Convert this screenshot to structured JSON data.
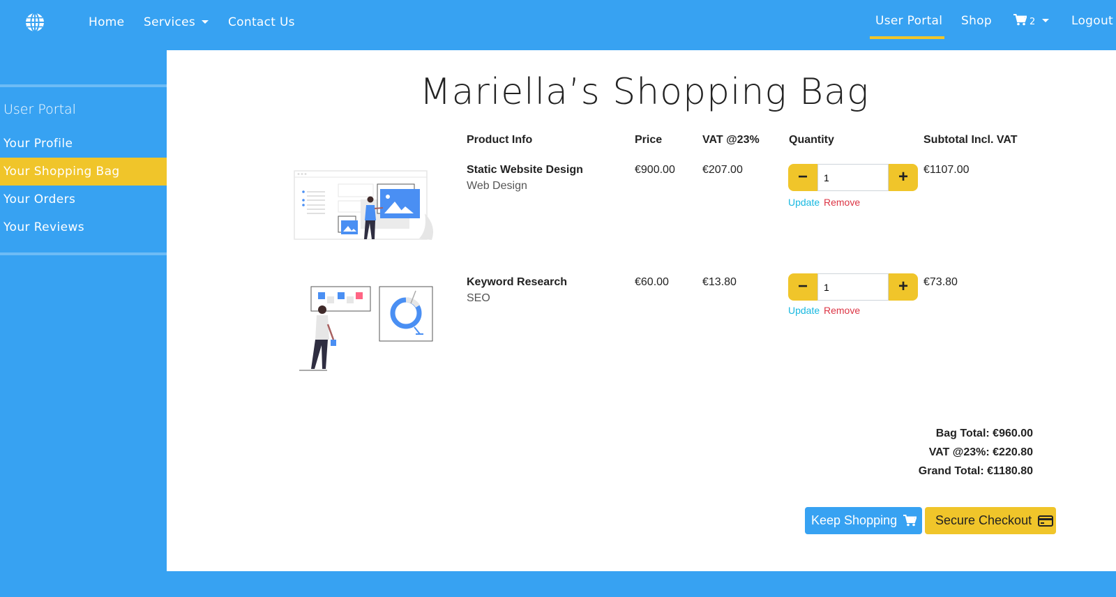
{
  "nav": {
    "logo_icon": "globe-icon",
    "home": "Home",
    "services": "Services",
    "contact": "Contact Us",
    "user_portal": "User Portal",
    "shop": "Shop",
    "cart_icon": "cart-icon",
    "cart_count": "2",
    "logout": "Logout"
  },
  "sidebar": {
    "title": "User Portal",
    "items": [
      {
        "label": "Your Profile",
        "active": false
      },
      {
        "label": "Your Shopping Bag",
        "active": true
      },
      {
        "label": "Your Orders",
        "active": false
      },
      {
        "label": "Your Reviews",
        "active": false
      }
    ]
  },
  "page": {
    "title": "Mariella’s Shopping Bag"
  },
  "table": {
    "headers": [
      "Product Info",
      "Price",
      "VAT @23%",
      "Quantity",
      "Subtotal Incl. VAT"
    ],
    "rows": [
      {
        "name": "Static Website Design",
        "category": "Web Design",
        "price": "€900.00",
        "vat": "€207.00",
        "quantity": "1",
        "subtotal": "€1107.00",
        "image_icon": "web-design-illustration"
      },
      {
        "name": "Keyword Research",
        "category": "SEO",
        "price": "€60.00",
        "vat": "€13.80",
        "quantity": "1",
        "subtotal": "€73.80",
        "image_icon": "seo-illustration"
      }
    ],
    "update_label": "Update",
    "remove_label": "Remove"
  },
  "totals": {
    "bag_total": "Bag Total: €960.00",
    "vat": "VAT @23%: €220.80",
    "grand_total": "Grand Total: €1180.80"
  },
  "actions": {
    "keep_shopping": "Keep Shopping",
    "secure_checkout": "Secure Checkout"
  },
  "colors": {
    "brand_blue": "#37a2f2",
    "accent_yellow": "#f0c52a",
    "update_link": "#17b8e0",
    "remove_link": "#dc3545"
  }
}
